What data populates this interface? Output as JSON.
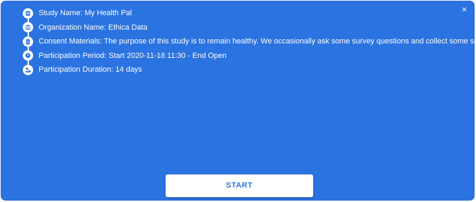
{
  "dialog": {
    "close_glyph": "×",
    "items": [
      {
        "icon": "document-icon",
        "text": "Study Name: My Health Pal"
      },
      {
        "icon": "institution-icon",
        "text": "Organization Name: Ethica Data"
      },
      {
        "icon": "clipboard-icon",
        "text": "Consent Materials: The purpose of this study is to remain healthy. We occasionally ask some survey questions and collect some sensor da"
      },
      {
        "icon": "clock-icon",
        "text": "Participation Period: Start 2020-11-18 11:30 - End Open"
      },
      {
        "icon": "person-timer-icon",
        "text": "Participation Duration: 14 days"
      }
    ],
    "start_label": "START"
  },
  "colors": {
    "panel_background": "#2b73e0",
    "button_text": "#2b73e0",
    "button_background": "#ffffff",
    "icon_background": "#ffffff"
  }
}
